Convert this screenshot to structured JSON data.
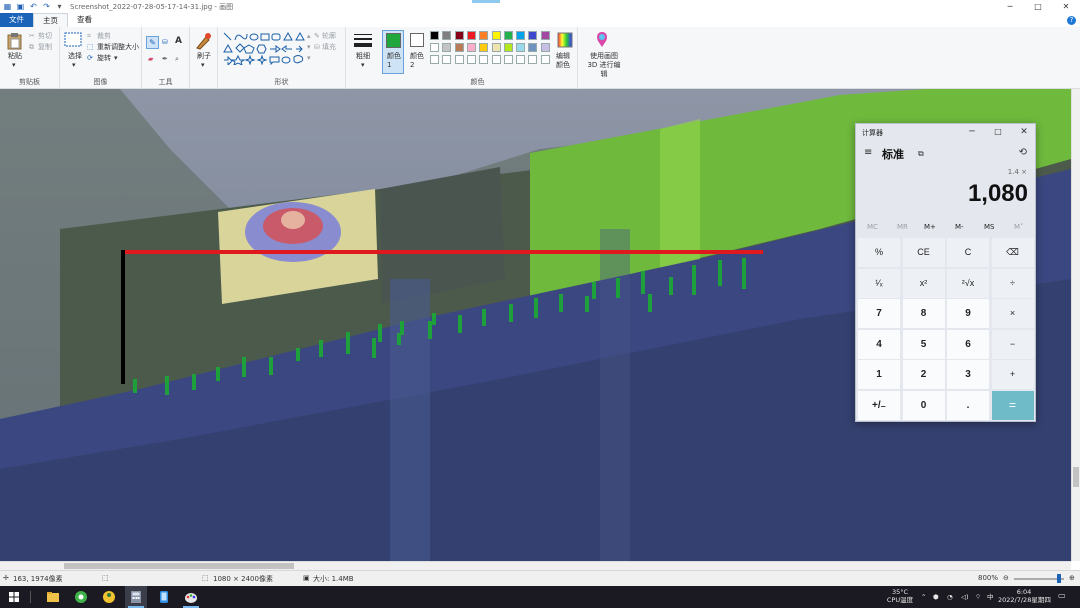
{
  "window": {
    "title": "Screenshot_2022-07-28-05-17-14-31.jpg - 画图",
    "controls": [
      "─",
      "□",
      "✕"
    ]
  },
  "ribbon_tabs": [
    "文件",
    "主页",
    "查看"
  ],
  "ribbon": {
    "clipboard": {
      "paste": "粘贴",
      "cut": "剪切",
      "copy": "复制",
      "group": "剪贴板"
    },
    "image": {
      "select": "选择",
      "crop": "裁剪",
      "resize": "重新调整大小",
      "rotate": "旋转",
      "group": "图像"
    },
    "tools": {
      "group": "工具"
    },
    "brushes": {
      "label": "刷子"
    },
    "shapes": {
      "outline": "轮廓",
      "fill": "填充",
      "group": "形状"
    },
    "size": {
      "label": "粗细"
    },
    "colors": {
      "color1": "颜色 1",
      "color2": "颜色 2",
      "edit": "编辑颜色",
      "group": "颜色",
      "color1_value": "#22a63e",
      "color2_value": "#ffffff",
      "palette": [
        "#000000",
        "#7f7f7f",
        "#880015",
        "#ed1c24",
        "#ff7f27",
        "#fff200",
        "#22b14c",
        "#00a2e8",
        "#3f48cc",
        "#a349a4",
        "#ffffff",
        "#c3c3c3",
        "#b97a57",
        "#ffaec9",
        "#ffc90e",
        "#efe4b0",
        "#b5e61d",
        "#99d9ea",
        "#7092be",
        "#c8bfe7"
      ]
    },
    "paint3d": "使用画图 3D 进行编辑"
  },
  "statusbar": {
    "cursor": "163, 1974像素",
    "dimensions": "1080 × 2400像素",
    "size": "大小: 1.4MB",
    "zoom": "800%"
  },
  "calculator": {
    "title": "计算器",
    "mode": "标准",
    "expression": "1.4 ×",
    "display": "1,080",
    "memory": [
      "MC",
      "MR",
      "M+",
      "M-",
      "MS",
      "M˅"
    ],
    "keys": [
      [
        "%",
        "CE",
        "C",
        "⌫"
      ],
      [
        "¹⁄ₓ",
        "x²",
        "²√x",
        "÷"
      ],
      [
        "7",
        "8",
        "9",
        "×"
      ],
      [
        "4",
        "5",
        "6",
        "−"
      ],
      [
        "1",
        "2",
        "3",
        "+"
      ],
      [
        "+/₋",
        "0",
        ".",
        "="
      ]
    ]
  },
  "taskbar": {
    "weather": "35°C",
    "cpu": "CPU温度",
    "ime": "中",
    "time": "6:04",
    "date": "2022/7/28星期四"
  },
  "colors": {
    "accent": "#1a63b8",
    "equals_key": "#6fbcc8",
    "red_line": "#e0191e",
    "green_ticks": "#1ea03a"
  }
}
